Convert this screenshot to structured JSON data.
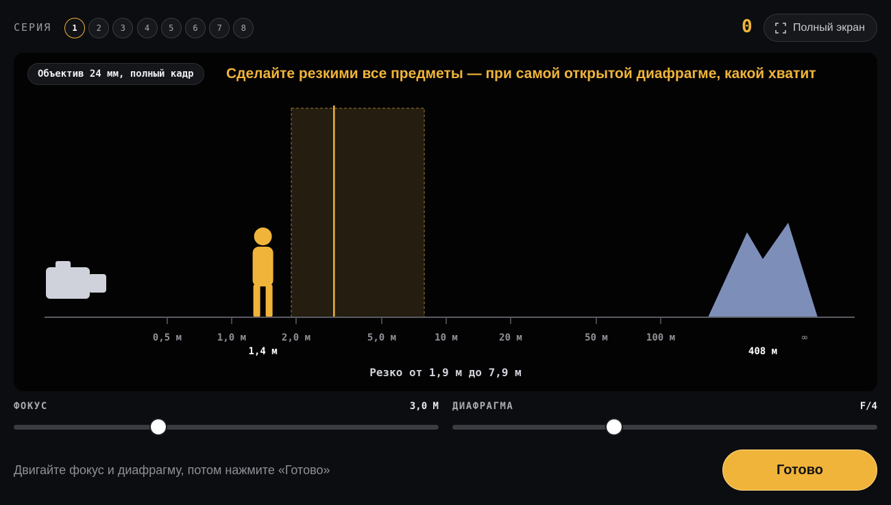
{
  "series": {
    "label": "СЕРИЯ",
    "items": [
      "1",
      "2",
      "3",
      "4",
      "5",
      "6",
      "7",
      "8"
    ],
    "active": "1"
  },
  "score": "0",
  "fullscreen": {
    "label": "Полный экран",
    "icon": "fullscreen-icon"
  },
  "scene": {
    "lens": "Объектив 24 мм, полный кадр",
    "task": "Сделайте резкими все предметы — при самой открытой диафрагме, какой хватит",
    "ticks": [
      {
        "label": "0,5 м",
        "meters": 0.5
      },
      {
        "label": "1,0 м",
        "meters": 1.0
      },
      {
        "label": "2,0 м",
        "meters": 2.0
      },
      {
        "label": "5,0 м",
        "meters": 5.0
      },
      {
        "label": "10 м",
        "meters": 10
      },
      {
        "label": "20 м",
        "meters": 20
      },
      {
        "label": "50 м",
        "meters": 50
      },
      {
        "label": "100 м",
        "meters": 100
      }
    ],
    "infinity_label": "∞",
    "person": {
      "distance_label": "1,4 м",
      "meters": 1.4
    },
    "mountain": {
      "distance_label": "408 м",
      "meters": 408
    },
    "focus_meters": 3.0,
    "dof_near_meters": 1.9,
    "dof_far_meters": 7.9,
    "sharp_text": "Резко от 1,9 м до 7,9 м",
    "colors": {
      "accent": "#f0b43a",
      "mountain": "#7d8fb8",
      "camera": "#cfd2da"
    }
  },
  "controls": {
    "focus": {
      "label": "ФОКУС",
      "value": "3,0 М",
      "fraction": 0.34
    },
    "aperture": {
      "label": "ДИАФРАГМА",
      "value": "F/4",
      "fraction": 0.38
    }
  },
  "footer": {
    "hint": "Двигайте фокус и диафрагму, потом нажмите «Готово»",
    "done_label": "Готово"
  }
}
